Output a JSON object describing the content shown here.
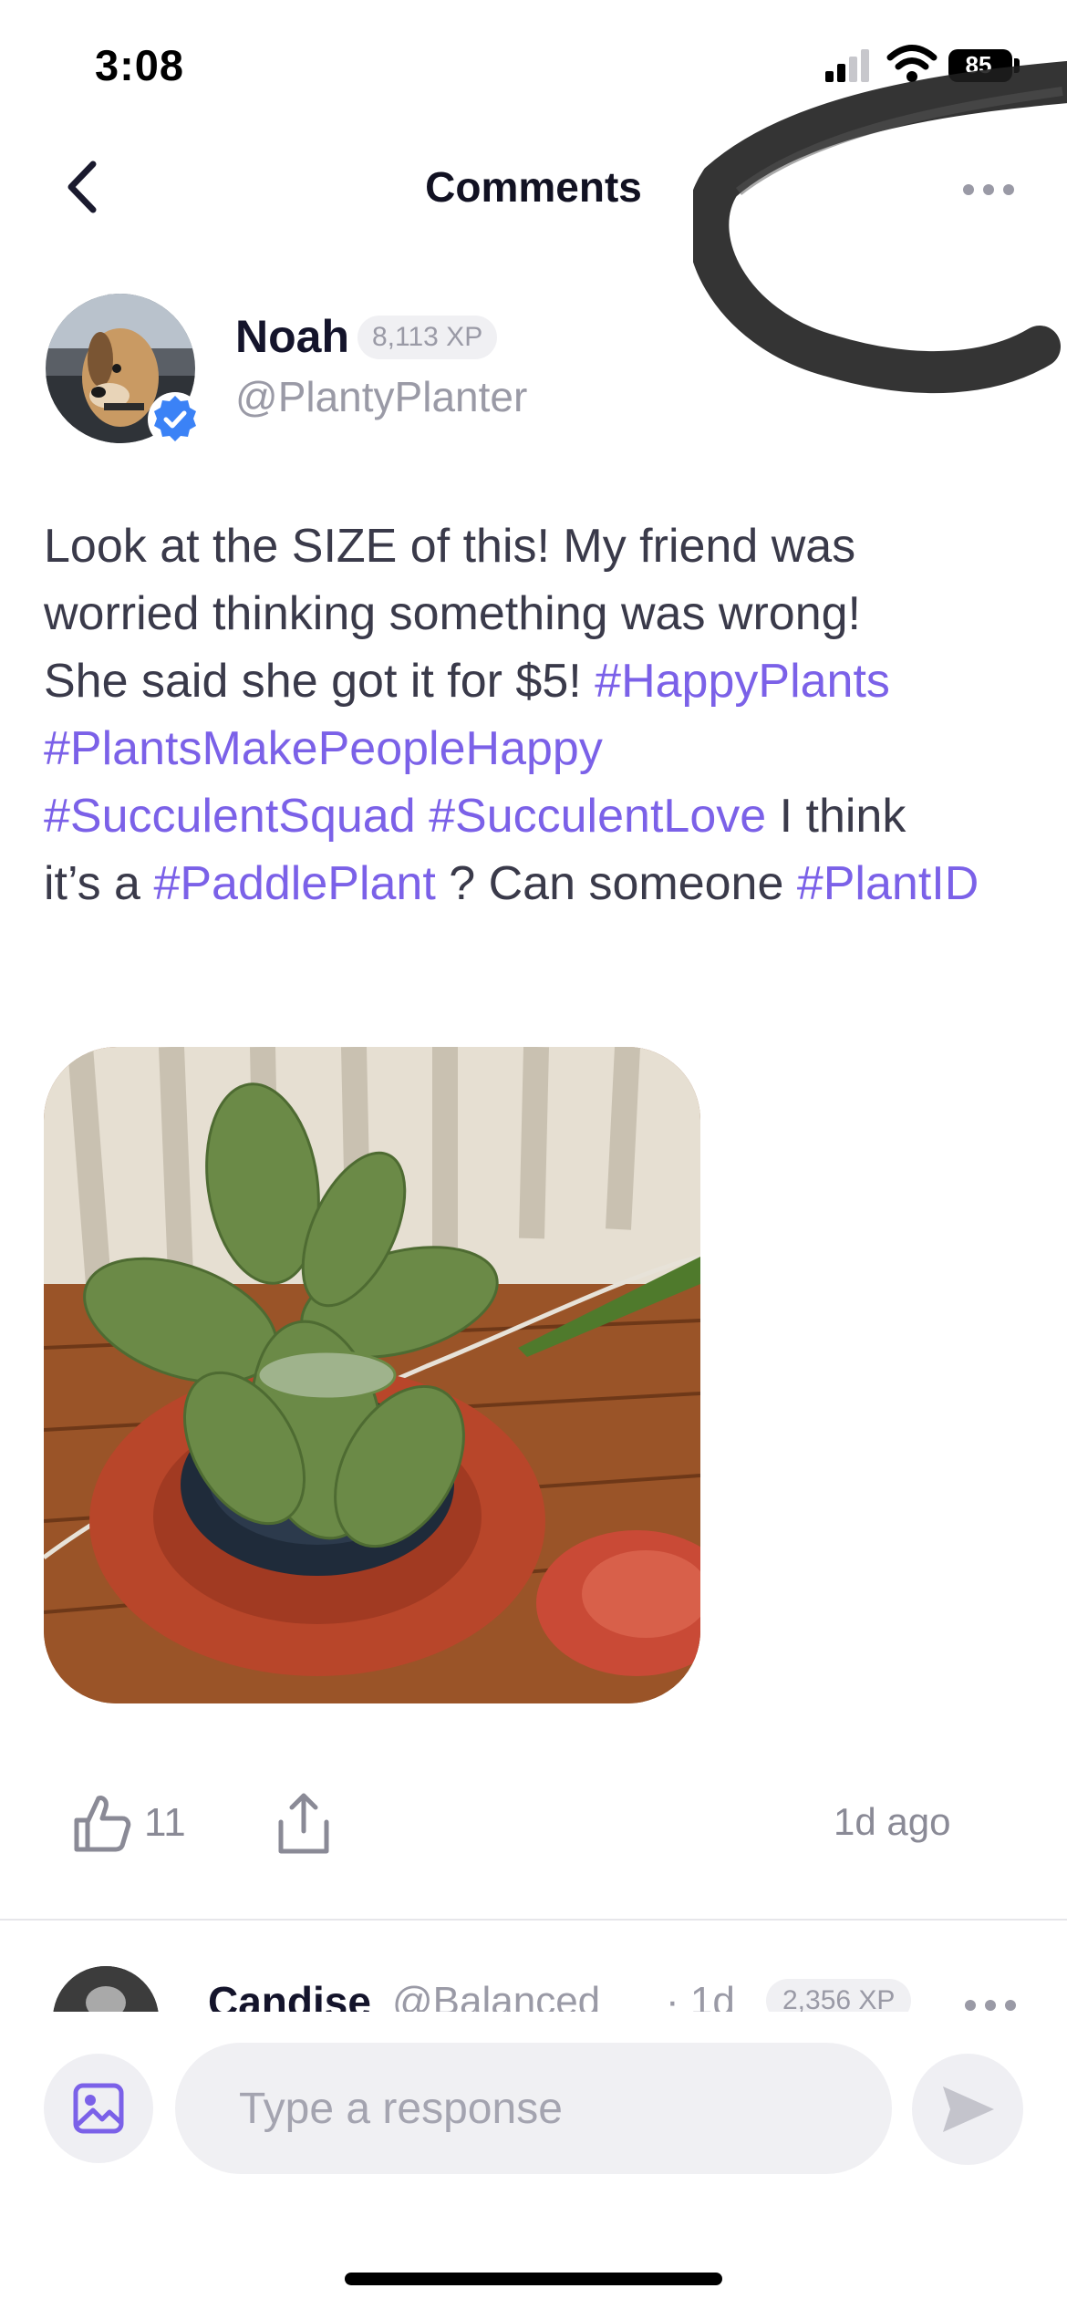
{
  "status_bar": {
    "time": "3:08",
    "battery": "85"
  },
  "header": {
    "title": "Comments"
  },
  "post": {
    "author": {
      "name": "Noah",
      "xp": "8,113 XP",
      "handle": "@PlantyPlanter",
      "verified": true
    },
    "text_lines": [
      [
        {
          "t": "Look at the SIZE of this! My friend was"
        }
      ],
      [
        {
          "t": "worried thinking something was wrong!"
        }
      ],
      [
        {
          "t": "She said she got it for $5! "
        },
        {
          "t": "#HappyPlants",
          "tag": true
        }
      ],
      [
        {
          "t": "#PlantsMakePeopleHappy",
          "tag": true
        }
      ],
      [
        {
          "t": "#SucculentSquad",
          "tag": true
        },
        {
          "t": " "
        },
        {
          "t": "#SucculentLove",
          "tag": true
        },
        {
          "t": " I think"
        }
      ],
      [
        {
          "t": "it’s a "
        },
        {
          "t": "#PaddlePlant",
          "tag": true
        },
        {
          "t": " ? Can someone "
        },
        {
          "t": "#PlantID",
          "tag": true
        }
      ]
    ],
    "like_count": "11",
    "time_ago": "1d ago"
  },
  "next_comment": {
    "name": "Candise",
    "handle": "@Balanced",
    "time": "· 1d",
    "xp": "2,356 XP"
  },
  "compose": {
    "placeholder": "Type a response"
  },
  "colors": {
    "accent": "#7b61e8",
    "verified": "#3b82f6",
    "muted": "#9a9aa6"
  },
  "icons": {
    "back": "chevron-left-icon",
    "more": "ellipsis-icon",
    "like": "thumbs-up-icon",
    "share": "share-icon",
    "image": "image-icon",
    "send": "send-icon",
    "verified": "verified-check-icon"
  }
}
